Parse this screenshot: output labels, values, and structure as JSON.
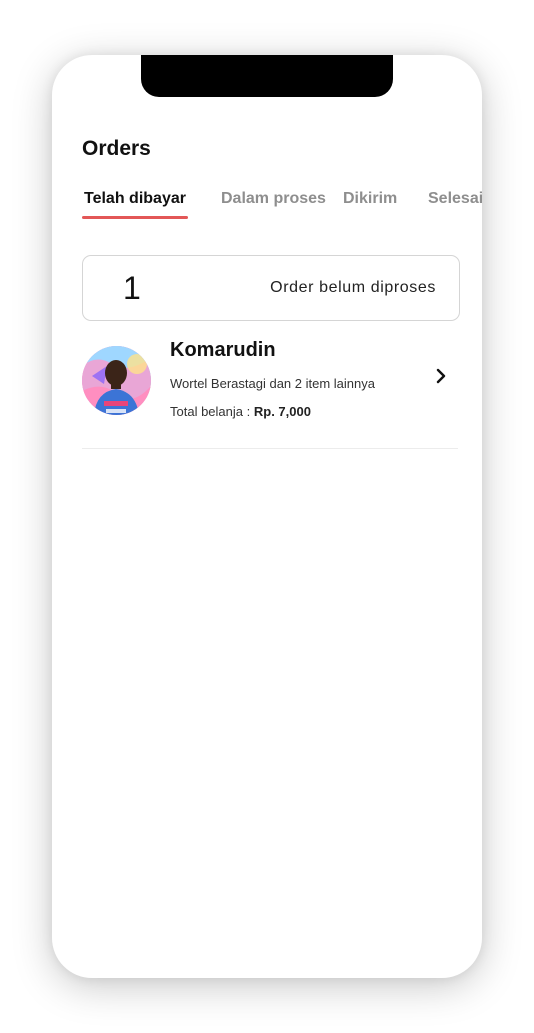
{
  "page": {
    "title": "Orders"
  },
  "tabs": [
    {
      "label": "Telah dibayar",
      "active": true
    },
    {
      "label": "Dalam proses",
      "active": false
    },
    {
      "label": "Dikirim",
      "active": false
    },
    {
      "label": "Selesai",
      "active": false
    }
  ],
  "summary": {
    "count": "1",
    "label": "Order belum diproses"
  },
  "orders": [
    {
      "customer": "Komarudin",
      "items_text": "Wortel Berastagi dan 2 item lainnya",
      "total_label": "Total belanja :",
      "total_amount": "Rp. 7,000",
      "icon": "chevron-right-icon"
    }
  ],
  "colors": {
    "accent": "#e35757",
    "inactive_tab": "#8e8e8e",
    "text": "#111111"
  }
}
